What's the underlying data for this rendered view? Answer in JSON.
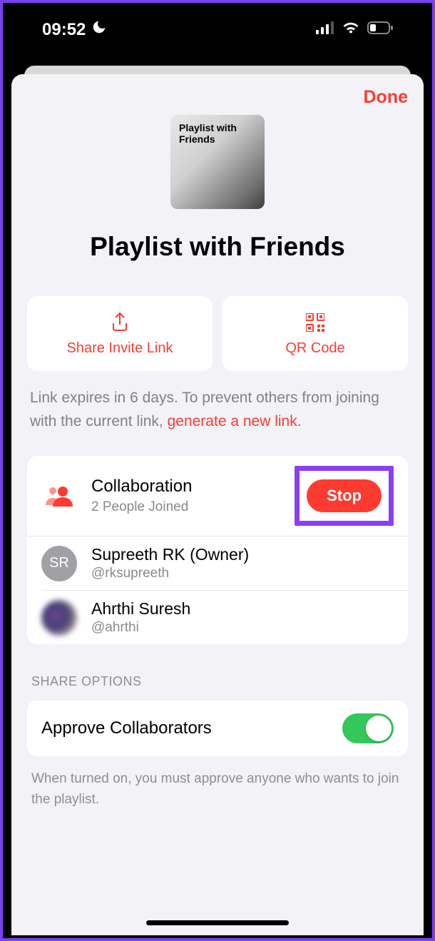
{
  "status": {
    "time": "09:52"
  },
  "header": {
    "done": "Done"
  },
  "artwork": {
    "label": "Playlist with Friends"
  },
  "title": "Playlist with Friends",
  "actions": {
    "share": "Share Invite Link",
    "qr": "QR Code"
  },
  "hint": {
    "prefix": "Link expires in 6 days. To prevent others from joining with the current link, ",
    "link": "generate a new link",
    "suffix": "."
  },
  "collab": {
    "title": "Collaboration",
    "subtitle": "2 People Joined",
    "stop": "Stop"
  },
  "people": [
    {
      "initials": "SR",
      "name": "Supreeth RK (Owner)",
      "handle": "@rksupreeth"
    },
    {
      "initials": "",
      "name": "Ahrthi Suresh",
      "handle": "@ahrthi"
    }
  ],
  "shareOptions": {
    "sectionLabel": "SHARE OPTIONS",
    "approve": "Approve Collaborators",
    "approveHint": "When turned on, you must approve anyone who wants to join the playlist."
  }
}
